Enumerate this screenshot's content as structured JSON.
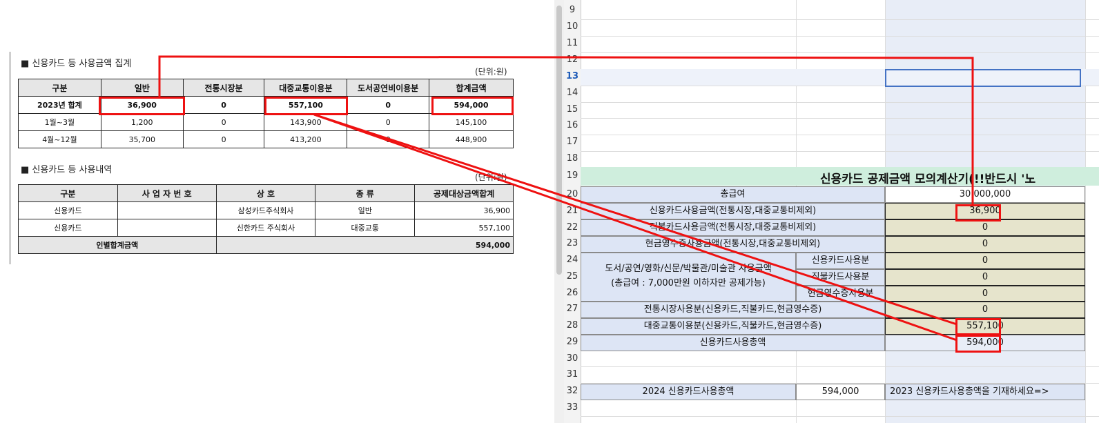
{
  "doc": {
    "section1_title": "■ 신용카드 등 사용금액 집계",
    "section1_unit": "(단위:원)",
    "summary_headers": [
      "구분",
      "일반",
      "전통시장분",
      "대중교통이용분",
      "도서공연비이용분",
      "합계금액"
    ],
    "summary_rows": [
      [
        "2023년 합계",
        "36,900",
        "0",
        "557,100",
        "0",
        "594,000"
      ],
      [
        "1월~3월",
        "1,200",
        "0",
        "143,900",
        "0",
        "145,100"
      ],
      [
        "4월~12월",
        "35,700",
        "0",
        "413,200",
        "0",
        "448,900"
      ]
    ],
    "section2_title": "■ 신용카드 등 사용내역",
    "section2_unit": "(단위:원)",
    "detail_headers": [
      "구분",
      "사 업 자 번 호",
      "상 호",
      "종 류",
      "공제대상금액합계"
    ],
    "detail_rows": [
      [
        "신용카드",
        "",
        "삼성카드주식회사",
        "일반",
        "36,900"
      ],
      [
        "신용카드",
        "",
        "신한카드 주식회사",
        "대중교통",
        "557,100"
      ]
    ],
    "detail_total_label": "인별합계금액",
    "detail_total_value": "594,000"
  },
  "sheet": {
    "row_numbers": [
      "9",
      "10",
      "11",
      "12",
      "13",
      "14",
      "15",
      "16",
      "17",
      "18",
      "19",
      "20",
      "21",
      "22",
      "23",
      "24",
      "25",
      "26",
      "27",
      "28",
      "29",
      "30",
      "31",
      "32",
      "33"
    ],
    "selected_row": "13",
    "title": "신용카드 공제금액 모의계산기(!!반드시 '노",
    "r20_label": "총급여",
    "r20_value": "30,000,000",
    "r21_label": "신용카드사용금액(전통시장,대중교통비제외)",
    "r21_value": "36,900",
    "r22_label": "직불카드사용금액(전통시장,대중교통비제외)",
    "r22_value": "0",
    "r23_label": "현금영수증사용금액(전통시장,대중교통비제외)",
    "r23_value": "0",
    "books_label_line1": "도서/공연/영화/신문/박물관/미술관 사용금액",
    "books_label_line2": "(총급여 : 7,000만원 이하자만 공제가능)",
    "r24_sub": "신용카드사용분",
    "r24_value": "0",
    "r25_sub": "직불카드사용분",
    "r25_value": "0",
    "r26_sub": "현금영수증사용분",
    "r26_value": "0",
    "r27_label": "전통시장사용분(신용카드,직불카드,현금영수증)",
    "r27_value": "0",
    "r28_label": "대중교통이용분(신용카드,직불카드,현금영수증)",
    "r28_value": "557,100",
    "r29_label": "신용카드사용총액",
    "r29_value": "594,000",
    "r32_label": "2024 신용카드사용총액",
    "r32_value": "594,000",
    "r32_note": "2023 신용카드사용총액을 기재하세요=>"
  },
  "colors": {
    "highlight_red": "#e11111",
    "label_blue": "#dde5f5",
    "input_tan": "#e6e4cc",
    "title_green": "#cfeedd",
    "select_blue": "#4472c4"
  }
}
